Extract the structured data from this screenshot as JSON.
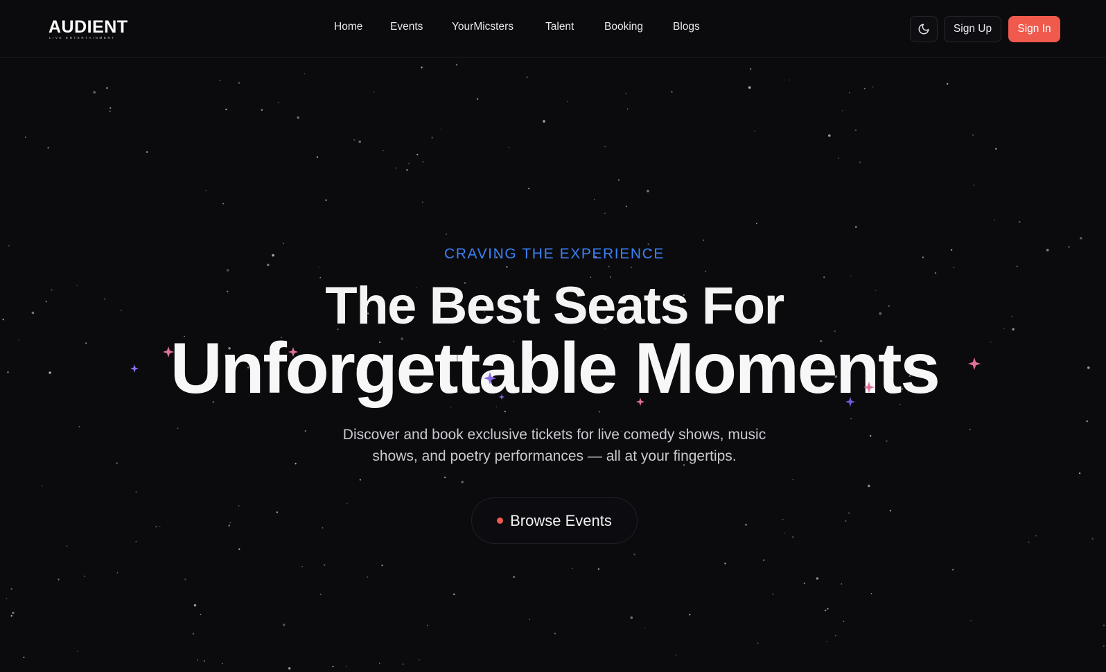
{
  "brand": {
    "name": "AUDIENT",
    "tagline": "LIVE ENTERTAINMENT"
  },
  "nav": {
    "items": [
      {
        "label": "Home"
      },
      {
        "label": "Events"
      },
      {
        "label": "YourMicsters"
      },
      {
        "label": "Talent"
      },
      {
        "label": "Booking"
      },
      {
        "label": "Blogs"
      }
    ]
  },
  "header": {
    "theme_icon": "moon-icon",
    "signup_label": "Sign Up",
    "signin_label": "Sign In"
  },
  "hero": {
    "eyebrow": "CRAVING THE EXPERIENCE",
    "headline_line1": "The Best Seats For",
    "headline_line2": "Unforgettable Moments",
    "subtext_line1": "Discover and book exclusive tickets for live comedy shows, music",
    "subtext_line2": "shows, and poetry performances — all at your fingertips.",
    "cta_label": "Browse Events"
  },
  "colors": {
    "background": "#0b0b0e",
    "accent": "#ef5a4d",
    "eyebrow": "#3b82f6",
    "text": "#ffffff",
    "muted_text": "#c9c9cf",
    "border": "#26262c",
    "sparkle_pink": "#e2709b",
    "sparkle_purple": "#8b6cf0"
  }
}
